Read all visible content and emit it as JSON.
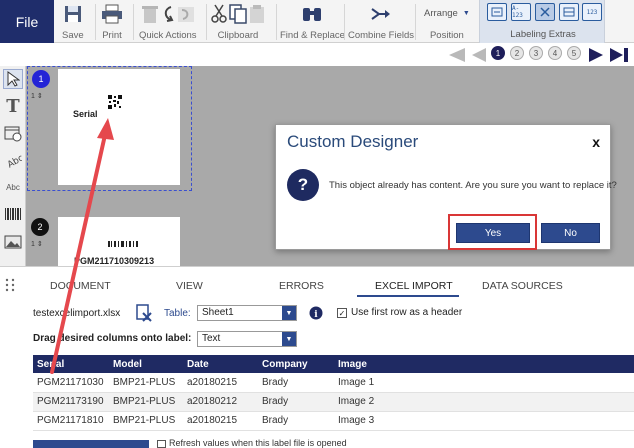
{
  "ribbon": {
    "file": "File",
    "save": "Save",
    "print": "Print",
    "quick_actions": "Quick Actions",
    "clipboard": "Clipboard",
    "find_replace": "Find & Replace",
    "combine_fields": "Combine Fields",
    "arrange": "Arrange",
    "position": "Position",
    "labeling_extras": "Labeling Extras",
    "le_icons": [
      "A-123",
      "123"
    ]
  },
  "pager": {
    "pages": [
      "1",
      "2",
      "3",
      "4",
      "5"
    ],
    "active": "1"
  },
  "canvas": {
    "label1": {
      "number": "1",
      "copies": "1",
      "text": "Serial"
    },
    "label2": {
      "number": "2",
      "copies": "1",
      "text": "PGM211710309213"
    }
  },
  "dialog": {
    "title": "Custom Designer",
    "close": "x",
    "icon": "?",
    "message": "This object already has content. Are you sure you want to replace it?",
    "yes": "Yes",
    "no": "No"
  },
  "tabs": [
    "DOCUMENT",
    "VIEW",
    "ERRORS",
    "EXCEL IMPORT",
    "DATA SOURCES"
  ],
  "excel": {
    "file_name": "testexcelimport.xlsx",
    "table_label": "Table:",
    "table_value": "Sheet1",
    "header_checkbox": "Use first row as a header",
    "drag_label": "Drag desired columns onto label:",
    "drag_value": "Text",
    "columns": [
      "Serial",
      "Model",
      "Date",
      "Company",
      "Image"
    ],
    "rows": [
      [
        "PGM21171030",
        "BMP21-PLUS",
        "a20180215",
        "Brady",
        "Image 1"
      ],
      [
        "PGM21173190",
        "BMP21-PLUS",
        "a20180212",
        "Brady",
        "Image 2"
      ],
      [
        "PGM21171810",
        "BMP21-PLUS",
        "a20180215",
        "Brady",
        "Image 3"
      ]
    ],
    "refresh_text": "Refresh values when this label file is opened"
  },
  "colors": {
    "navy": "#1f2a63",
    "accent": "#2d4a8e",
    "highlight": "#d93636"
  }
}
